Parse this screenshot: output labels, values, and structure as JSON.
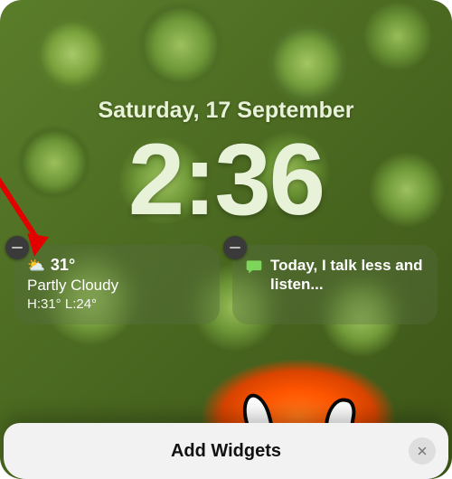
{
  "date_label": "Saturday, 17 September",
  "time_label": "2:36",
  "widgets": {
    "weather": {
      "temp": "31°",
      "condition": "Partly Cloudy",
      "high_low": "H:31° L:24°",
      "icon_name": "partly-cloudy-icon"
    },
    "affirmation": {
      "text": "Today, I talk less and listen...",
      "icon_name": "speech-bubble-icon"
    }
  },
  "sheet": {
    "title": "Add Widgets",
    "close_label": "Close"
  },
  "annotation": {
    "arrow_color": "#e30000"
  }
}
